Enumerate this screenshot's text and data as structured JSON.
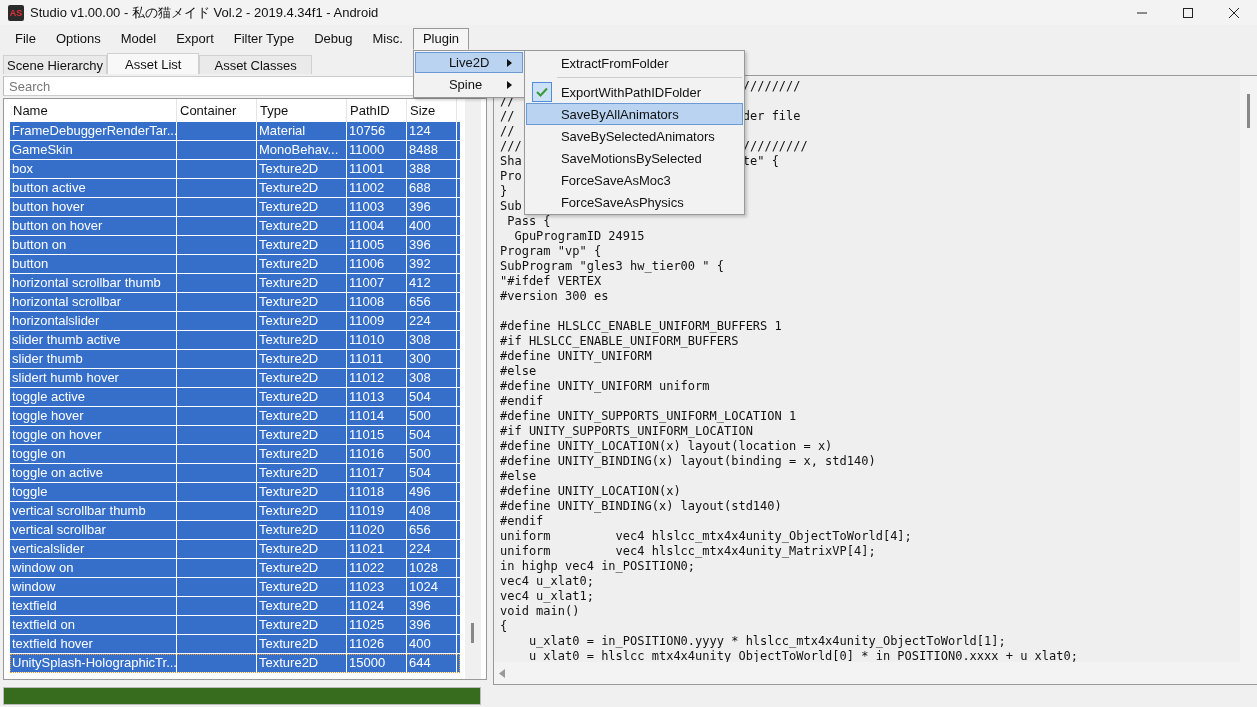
{
  "window": {
    "logo_text": "AS",
    "title": "Studio v1.00.00 - 私の猫メイド Vol.2 - 2019.4.34f1 - Android"
  },
  "menu_bar": [
    {
      "label": "File",
      "open": false
    },
    {
      "label": "Options",
      "open": false
    },
    {
      "label": "Model",
      "open": false
    },
    {
      "label": "Export",
      "open": false
    },
    {
      "label": "Filter Type",
      "open": false
    },
    {
      "label": "Debug",
      "open": false
    },
    {
      "label": "Misc.",
      "open": false
    },
    {
      "label": "Plugin",
      "open": true
    }
  ],
  "plugin_menu": [
    {
      "label": "Live2D",
      "selected": true
    },
    {
      "label": "Spine",
      "selected": false
    }
  ],
  "live2d_submenu": [
    {
      "kind": "item",
      "label": "ExtractFromFolder",
      "checked": false,
      "selected": false
    },
    {
      "kind": "separator"
    },
    {
      "kind": "item",
      "label": "ExportWithPathIDFolder",
      "checked": true,
      "selected": false
    },
    {
      "kind": "item",
      "label": "SaveByAllAnimators",
      "checked": false,
      "selected": true
    },
    {
      "kind": "item",
      "label": "SaveBySelectedAnimators",
      "checked": false,
      "selected": false
    },
    {
      "kind": "item",
      "label": "SaveMotionsBySelected",
      "checked": false,
      "selected": false
    },
    {
      "kind": "item",
      "label": "ForceSaveAsMoc3",
      "checked": false,
      "selected": false
    },
    {
      "kind": "item",
      "label": "ForceSaveAsPhysics",
      "checked": false,
      "selected": false
    }
  ],
  "tabs": [
    {
      "label": "Scene Hierarchy",
      "selected": false
    },
    {
      "label": "Asset List",
      "selected": true
    },
    {
      "label": "Asset Classes",
      "selected": false
    }
  ],
  "search": {
    "placeholder": "Search"
  },
  "table": {
    "columns": [
      "Name",
      "Container",
      "Type",
      "PathID",
      "Size"
    ],
    "rows": [
      {
        "cells": [
          "FrameDebuggerRenderTar...",
          "",
          "Material",
          "10756",
          "124"
        ],
        "selected": true,
        "focused": false
      },
      {
        "cells": [
          "GameSkin",
          "",
          "MonoBehav...",
          "11000",
          "8488"
        ],
        "selected": true,
        "focused": false
      },
      {
        "cells": [
          "box",
          "",
          "Texture2D",
          "11001",
          "388"
        ],
        "selected": true,
        "focused": false
      },
      {
        "cells": [
          "button active",
          "",
          "Texture2D",
          "11002",
          "688"
        ],
        "selected": true,
        "focused": false
      },
      {
        "cells": [
          "button hover",
          "",
          "Texture2D",
          "11003",
          "396"
        ],
        "selected": true,
        "focused": false
      },
      {
        "cells": [
          "button on hover",
          "",
          "Texture2D",
          "11004",
          "400"
        ],
        "selected": true,
        "focused": false
      },
      {
        "cells": [
          "button on",
          "",
          "Texture2D",
          "11005",
          "396"
        ],
        "selected": true,
        "focused": false
      },
      {
        "cells": [
          "button",
          "",
          "Texture2D",
          "11006",
          "392"
        ],
        "selected": true,
        "focused": false
      },
      {
        "cells": [
          "horizontal scrollbar thumb",
          "",
          "Texture2D",
          "11007",
          "412"
        ],
        "selected": true,
        "focused": false
      },
      {
        "cells": [
          "horizontal scrollbar",
          "",
          "Texture2D",
          "11008",
          "656"
        ],
        "selected": true,
        "focused": false
      },
      {
        "cells": [
          "horizontalslider",
          "",
          "Texture2D",
          "11009",
          "224"
        ],
        "selected": true,
        "focused": false
      },
      {
        "cells": [
          "slider thumb active",
          "",
          "Texture2D",
          "11010",
          "308"
        ],
        "selected": true,
        "focused": false
      },
      {
        "cells": [
          "slider thumb",
          "",
          "Texture2D",
          "11011",
          "300"
        ],
        "selected": true,
        "focused": false
      },
      {
        "cells": [
          "slidert humb hover",
          "",
          "Texture2D",
          "11012",
          "308"
        ],
        "selected": true,
        "focused": false
      },
      {
        "cells": [
          "toggle active",
          "",
          "Texture2D",
          "11013",
          "504"
        ],
        "selected": true,
        "focused": false
      },
      {
        "cells": [
          "toggle hover",
          "",
          "Texture2D",
          "11014",
          "500"
        ],
        "selected": true,
        "focused": false
      },
      {
        "cells": [
          "toggle on hover",
          "",
          "Texture2D",
          "11015",
          "504"
        ],
        "selected": true,
        "focused": false
      },
      {
        "cells": [
          "toggle on",
          "",
          "Texture2D",
          "11016",
          "500"
        ],
        "selected": true,
        "focused": false
      },
      {
        "cells": [
          "toggle on active",
          "",
          "Texture2D",
          "11017",
          "504"
        ],
        "selected": true,
        "focused": false
      },
      {
        "cells": [
          "toggle",
          "",
          "Texture2D",
          "11018",
          "496"
        ],
        "selected": true,
        "focused": false
      },
      {
        "cells": [
          "vertical scrollbar thumb",
          "",
          "Texture2D",
          "11019",
          "408"
        ],
        "selected": true,
        "focused": false
      },
      {
        "cells": [
          "vertical scrollbar",
          "",
          "Texture2D",
          "11020",
          "656"
        ],
        "selected": true,
        "focused": false
      },
      {
        "cells": [
          "verticalslider",
          "",
          "Texture2D",
          "11021",
          "224"
        ],
        "selected": true,
        "focused": false
      },
      {
        "cells": [
          "window on",
          "",
          "Texture2D",
          "11022",
          "1028"
        ],
        "selected": true,
        "focused": false
      },
      {
        "cells": [
          "window",
          "",
          "Texture2D",
          "11023",
          "1024"
        ],
        "selected": true,
        "focused": false
      },
      {
        "cells": [
          "textfield",
          "",
          "Texture2D",
          "11024",
          "396"
        ],
        "selected": true,
        "focused": false
      },
      {
        "cells": [
          "textfield on",
          "",
          "Texture2D",
          "11025",
          "396"
        ],
        "selected": true,
        "focused": false
      },
      {
        "cells": [
          "textfield hover",
          "",
          "Texture2D",
          "11026",
          "400"
        ],
        "selected": true,
        "focused": false
      },
      {
        "cells": [
          "UnitySplash-HolographicTr...",
          "",
          "Texture2D",
          "15000",
          "644"
        ],
        "selected": true,
        "focused": true
      }
    ]
  },
  "progress": {
    "level": 1
  },
  "code": [
    {
      "right": "////////"
    },
    {
      "text": "//"
    },
    {
      "text": "//",
      "right": "der file"
    },
    {
      "text": "//"
    },
    {
      "text": "///",
      "right": "/////////"
    },
    {
      "text": "Sha",
      "right": "te\" {"
    },
    {
      "text": "Pro"
    },
    {
      "text": "}"
    },
    {
      "text": "Sub"
    },
    {
      "text": " Pass {"
    },
    {
      "text": "  GpuProgramID 24915"
    },
    {
      "text": "Program \"vp\" {"
    },
    {
      "text": "SubProgram \"gles3 hw_tier00 \" {"
    },
    {
      "text": "\"#ifdef VERTEX"
    },
    {
      "text": "#version 300 es"
    },
    {
      "kind": "blank"
    },
    {
      "text": "#define HLSLCC_ENABLE_UNIFORM_BUFFERS 1"
    },
    {
      "text": "#if HLSLCC_ENABLE_UNIFORM_BUFFERS"
    },
    {
      "text": "#define UNITY_UNIFORM"
    },
    {
      "text": "#else"
    },
    {
      "text": "#define UNITY_UNIFORM uniform"
    },
    {
      "text": "#endif"
    },
    {
      "text": "#define UNITY_SUPPORTS_UNIFORM_LOCATION 1"
    },
    {
      "text": "#if UNITY_SUPPORTS_UNIFORM_LOCATION"
    },
    {
      "text": "#define UNITY_LOCATION(x) layout(location = x)"
    },
    {
      "text": "#define UNITY_BINDING(x) layout(binding = x, std140)"
    },
    {
      "text": "#else"
    },
    {
      "text": "#define UNITY_LOCATION(x)"
    },
    {
      "text": "#define UNITY_BINDING(x) layout(std140)"
    },
    {
      "text": "#endif"
    },
    {
      "text": "uniform         vec4 hlslcc_mtx4x4unity_ObjectToWorld[4];"
    },
    {
      "text": "uniform         vec4 hlslcc_mtx4x4unity_MatrixVP[4];"
    },
    {
      "text": "in highp vec4 in_POSITION0;"
    },
    {
      "text": "vec4 u_xlat0;"
    },
    {
      "text": "vec4 u_xlat1;"
    },
    {
      "text": "void main()"
    },
    {
      "text": "{"
    },
    {
      "text": "    u_xlat0 = in_POSITION0.yyyy * hlslcc_mtx4x4unity_ObjectToWorld[1];"
    },
    {
      "text": "    u_xlat0 = hlslcc_mtx4x4unity_ObjectToWorld[0] * in_POSITION0.xxxx + u_xlat0;"
    }
  ]
}
